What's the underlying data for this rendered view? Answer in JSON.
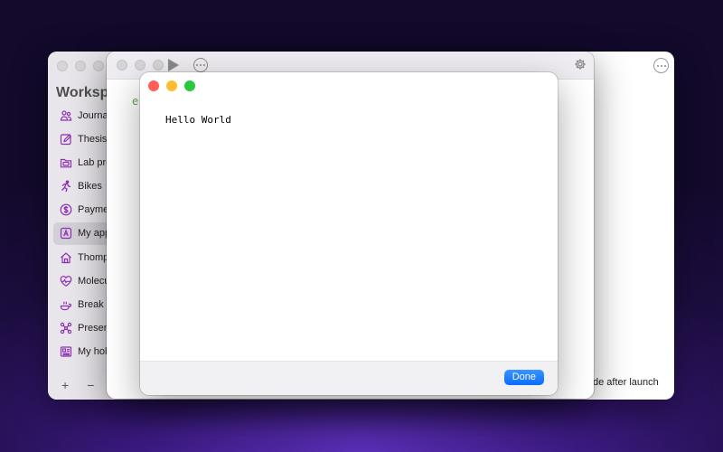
{
  "sidebar": {
    "title": "Workspace",
    "items": [
      {
        "label": "Journal",
        "icon": "people-icon"
      },
      {
        "label": "Thesis",
        "icon": "edit-icon"
      },
      {
        "label": "Lab project",
        "icon": "folder-icon"
      },
      {
        "label": "Bikes",
        "icon": "runner-icon"
      },
      {
        "label": "Payments",
        "icon": "dollar-icon"
      },
      {
        "label": "My app",
        "icon": "app-icon",
        "active": true
      },
      {
        "label": "Thompson",
        "icon": "house-icon"
      },
      {
        "label": "Molecules",
        "icon": "heart-pulse-icon"
      },
      {
        "label": "Break",
        "icon": "cup-icon"
      },
      {
        "label": "Presentation",
        "icon": "network-icon"
      },
      {
        "label": "My holiday",
        "icon": "newspaper-icon"
      }
    ],
    "add_label": "+",
    "remove_label": "−"
  },
  "back_window": {
    "footer_text": "de after launch"
  },
  "editor": {
    "code_char": "e"
  },
  "output_window": {
    "text": "Hello World",
    "done_label": "Done"
  },
  "colors": {
    "accent": "#0a6cff",
    "sidebar_icon": "#8e2fb5",
    "bg_purple": "#3a1a7e"
  }
}
